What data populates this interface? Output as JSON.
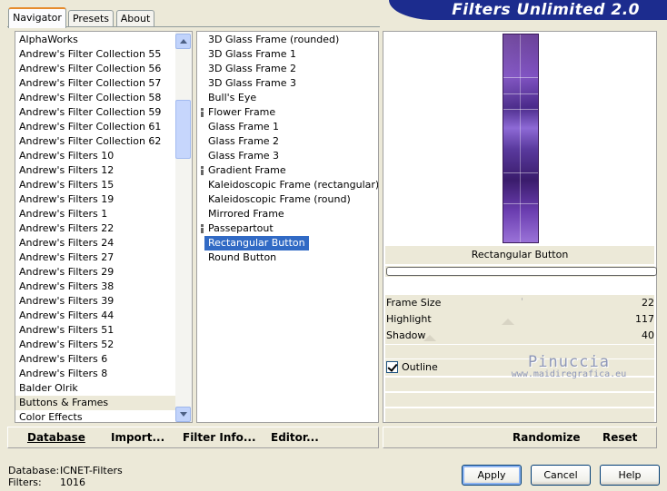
{
  "tabs": [
    {
      "label": "Navigator",
      "active": true
    },
    {
      "label": "Presets",
      "active": false
    },
    {
      "label": "About",
      "active": false
    }
  ],
  "banner": {
    "title": "Filters Unlimited 2.0",
    "color": "#1c2c8e"
  },
  "categories": {
    "items": [
      "AlphaWorks",
      "Andrew's Filter Collection 55",
      "Andrew's Filter Collection 56",
      "Andrew's Filter Collection 57",
      "Andrew's Filter Collection 58",
      "Andrew's Filter Collection 59",
      "Andrew's Filter Collection 61",
      "Andrew's Filter Collection 62",
      "Andrew's Filters 10",
      "Andrew's Filters 12",
      "Andrew's Filters 15",
      "Andrew's Filters 19",
      "Andrew's Filters 1",
      "Andrew's Filters 22",
      "Andrew's Filters 24",
      "Andrew's Filters 27",
      "Andrew's Filters 29",
      "Andrew's Filters 38",
      "Andrew's Filters 39",
      "Andrew's Filters 44",
      "Andrew's Filters 51",
      "Andrew's Filters 52",
      "Andrew's Filters 6",
      "Andrew's Filters 8",
      "Balder Olrik",
      "Buttons & Frames",
      "Color Effects"
    ],
    "selected": "Buttons & Frames"
  },
  "filters": {
    "items": [
      {
        "label": "3D Glass Frame (rounded)",
        "group": false
      },
      {
        "label": "3D Glass Frame 1",
        "group": false
      },
      {
        "label": "3D Glass Frame 2",
        "group": false
      },
      {
        "label": "3D Glass Frame 3",
        "group": false
      },
      {
        "label": "Bull's Eye",
        "group": false
      },
      {
        "label": "Flower Frame",
        "group": true
      },
      {
        "label": "Glass Frame 1",
        "group": false
      },
      {
        "label": "Glass Frame 2",
        "group": false
      },
      {
        "label": "Glass Frame 3",
        "group": false
      },
      {
        "label": "Gradient Frame",
        "group": true
      },
      {
        "label": "Kaleidoscopic Frame (rectangular)",
        "group": false
      },
      {
        "label": "Kaleidoscopic Frame (round)",
        "group": false
      },
      {
        "label": "Mirrored Frame",
        "group": false
      },
      {
        "label": "Passepartout",
        "group": true
      },
      {
        "label": "Rectangular Button",
        "group": false
      },
      {
        "label": "Round Button",
        "group": false
      }
    ],
    "selected": "Rectangular Button"
  },
  "preview": {
    "filter_name": "Rectangular Button"
  },
  "params": [
    {
      "label": "Frame Size",
      "value": "22",
      "level": 22
    },
    {
      "label": "Highlight",
      "value": "117",
      "level": 117
    },
    {
      "label": "Shadow",
      "value": "40",
      "level": 40
    }
  ],
  "outline": {
    "label": "Outline",
    "checked": true
  },
  "watermark": {
    "line1": "Pinuccia",
    "line2": "www.maidiregrafica.eu"
  },
  "toolbar": {
    "database": "Database",
    "import": "Import...",
    "filter_info": "Filter Info...",
    "editor": "Editor...",
    "randomize": "Randomize",
    "reset": "Reset"
  },
  "info": {
    "database_label": "Database:",
    "database_value": "ICNET-Filters",
    "filters_label": "Filters:",
    "filters_value": "1016"
  },
  "buttons": {
    "apply": "Apply",
    "cancel": "Cancel",
    "help": "Help"
  }
}
